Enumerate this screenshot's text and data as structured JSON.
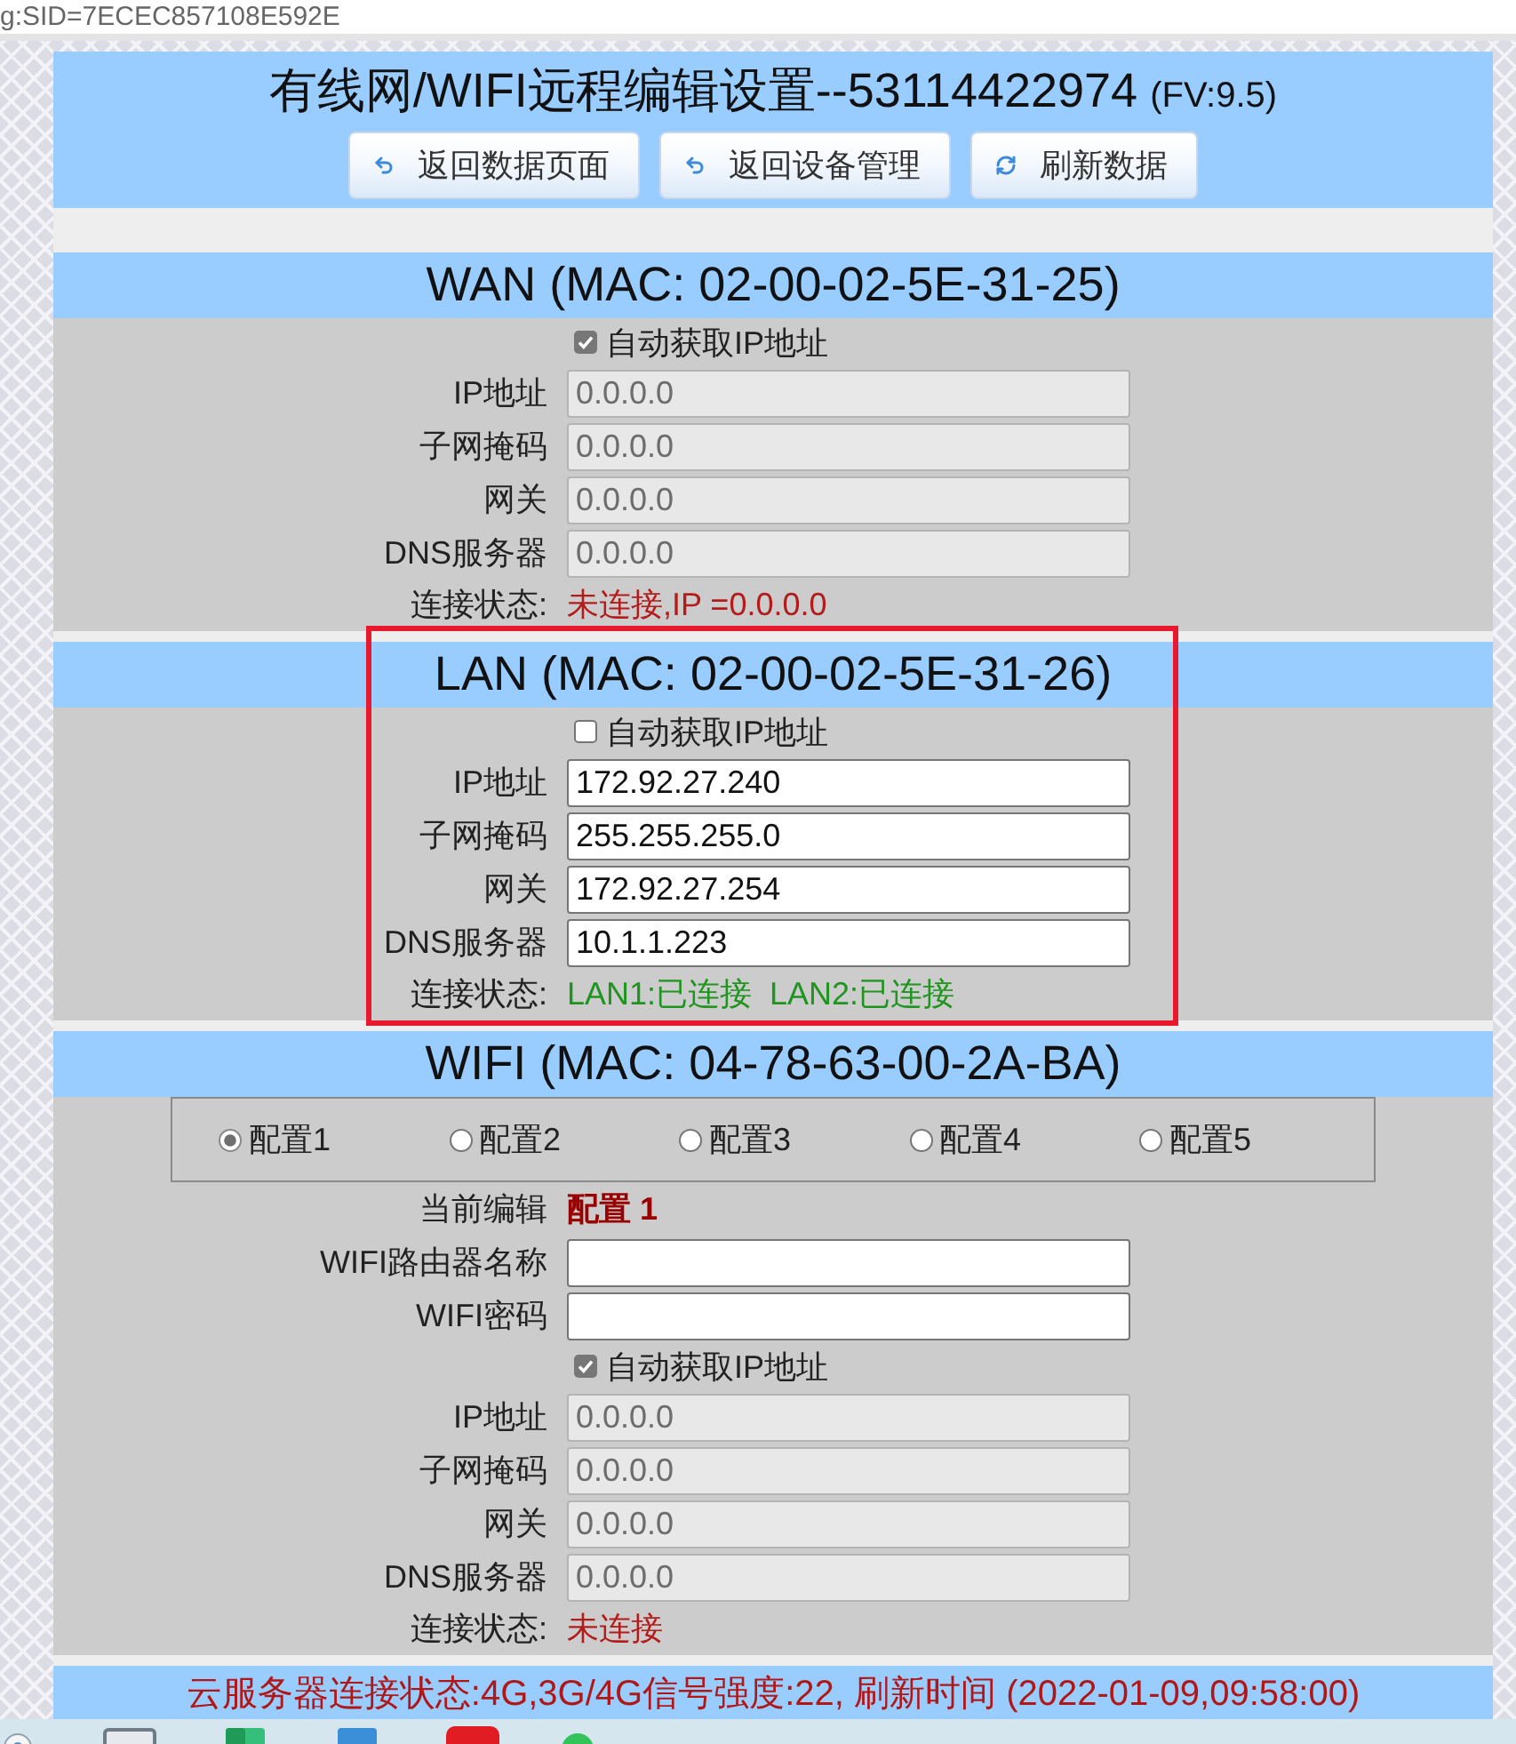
{
  "browser": {
    "url": "g:SID=7ECEC857108E592E"
  },
  "header": {
    "title": "有线网/WIFI远程编辑设置--53114422974",
    "version": "(FV:9.5)",
    "buttons": [
      {
        "kind": "back",
        "label": "返回数据页面"
      },
      {
        "kind": "back",
        "label": "返回设备管理"
      },
      {
        "kind": "refresh",
        "label": "刷新数据"
      }
    ]
  },
  "sections": [
    {
      "title": "WAN (MAC: 02-00-02-5E-31-25)",
      "highlighted": false,
      "rows": [
        {
          "kind": "checkbox",
          "label": "自动获取IP地址",
          "checked": true
        },
        {
          "kind": "field",
          "label": "IP地址",
          "value": "0.0.0.0",
          "disabled": true
        },
        {
          "kind": "field",
          "label": "子网掩码",
          "value": "0.0.0.0",
          "disabled": true
        },
        {
          "kind": "field",
          "label": "网关",
          "value": "0.0.0.0",
          "disabled": true
        },
        {
          "kind": "field",
          "label": "DNS服务器",
          "value": "0.0.0.0",
          "disabled": true
        },
        {
          "kind": "status",
          "label": "连接状态:",
          "values": [
            {
              "text": "未连接,IP =0.0.0.0",
              "connected": false
            }
          ]
        }
      ]
    },
    {
      "title": "LAN (MAC: 02-00-02-5E-31-26)",
      "highlighted": true,
      "rows": [
        {
          "kind": "checkbox",
          "label": "自动获取IP地址",
          "checked": false
        },
        {
          "kind": "field",
          "label": "IP地址",
          "value": "172.92.27.240",
          "disabled": false
        },
        {
          "kind": "field",
          "label": "子网掩码",
          "value": "255.255.255.0",
          "disabled": false
        },
        {
          "kind": "field",
          "label": "网关",
          "value": "172.92.27.254",
          "disabled": false
        },
        {
          "kind": "field",
          "label": "DNS服务器",
          "value": "10.1.1.223",
          "disabled": false
        },
        {
          "kind": "status",
          "label": "连接状态:",
          "values": [
            {
              "text": "LAN1:已连接",
              "connected": true
            },
            {
              "text": "LAN2:已连接",
              "connected": true
            }
          ]
        }
      ]
    },
    {
      "title": "WIFI (MAC: 04-78-63-00-2A-BA)",
      "highlighted": false,
      "rows": [
        {
          "kind": "radio_group",
          "options": [
            {
              "label": "配置1",
              "selected": true
            },
            {
              "label": "配置2",
              "selected": false
            },
            {
              "label": "配置3",
              "selected": false
            },
            {
              "label": "配置4",
              "selected": false
            },
            {
              "label": "配置5",
              "selected": false
            }
          ]
        },
        {
          "kind": "current",
          "label": "当前编辑",
          "value": "配置 1"
        },
        {
          "kind": "field",
          "label": "WIFI路由器名称",
          "disabled": false
        },
        {
          "kind": "field",
          "label": "WIFI密码",
          "disabled": false
        },
        {
          "kind": "checkbox",
          "label": "自动获取IP地址",
          "checked": true
        },
        {
          "kind": "field",
          "label": "IP地址",
          "value": "0.0.0.0",
          "disabled": true
        },
        {
          "kind": "field",
          "label": "子网掩码",
          "value": "0.0.0.0",
          "disabled": true
        },
        {
          "kind": "field",
          "label": "网关",
          "value": "0.0.0.0",
          "disabled": true
        },
        {
          "kind": "field",
          "label": "DNS服务器",
          "value": "0.0.0.0",
          "disabled": true
        },
        {
          "kind": "status",
          "label": "连接状态:",
          "values": [
            {
              "text": "未连接",
              "connected": false
            }
          ]
        }
      ]
    }
  ],
  "footer": {
    "text": "云服务器连接状态:4G,3G/4G信号强度:22, 刷新时间 (2022-01-09,09:58:00)"
  }
}
